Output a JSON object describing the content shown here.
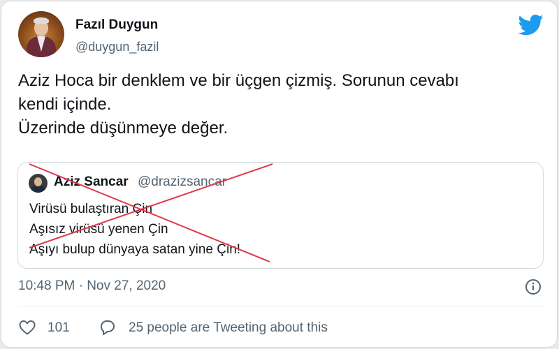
{
  "author": {
    "name": "Fazıl Duygun",
    "handle": "@duygun_fazil"
  },
  "tweet": {
    "lines": [
      "Aziz Hoca bir denklem ve bir üçgen çizmiş. Sorunun cevabı",
      "kendi içinde.",
      "Üzerinde düşünmeye değer."
    ]
  },
  "quoted_tweet": {
    "name": "Aziz Sancar",
    "handle": "@drazizsancar",
    "lines": [
      "Virüsü bulaştıran Çin",
      "Aşısız virüsü yenen Çin",
      "Aşıyı bulup dünyaya satan yine Çin!"
    ],
    "crossed_out": true,
    "cross_color": "#e0394a"
  },
  "meta": {
    "timestamp": "10:48 PM · Nov 27, 2020"
  },
  "engagement": {
    "likes": "101",
    "retweets_text": "25 people are Tweeting about this"
  },
  "colors": {
    "brand": "#1d9bf0",
    "text": "#0f1419",
    "secondary": "#536471"
  },
  "icons": [
    "twitter-bird-icon",
    "info-icon",
    "heart-icon",
    "speech-bubble-icon"
  ]
}
